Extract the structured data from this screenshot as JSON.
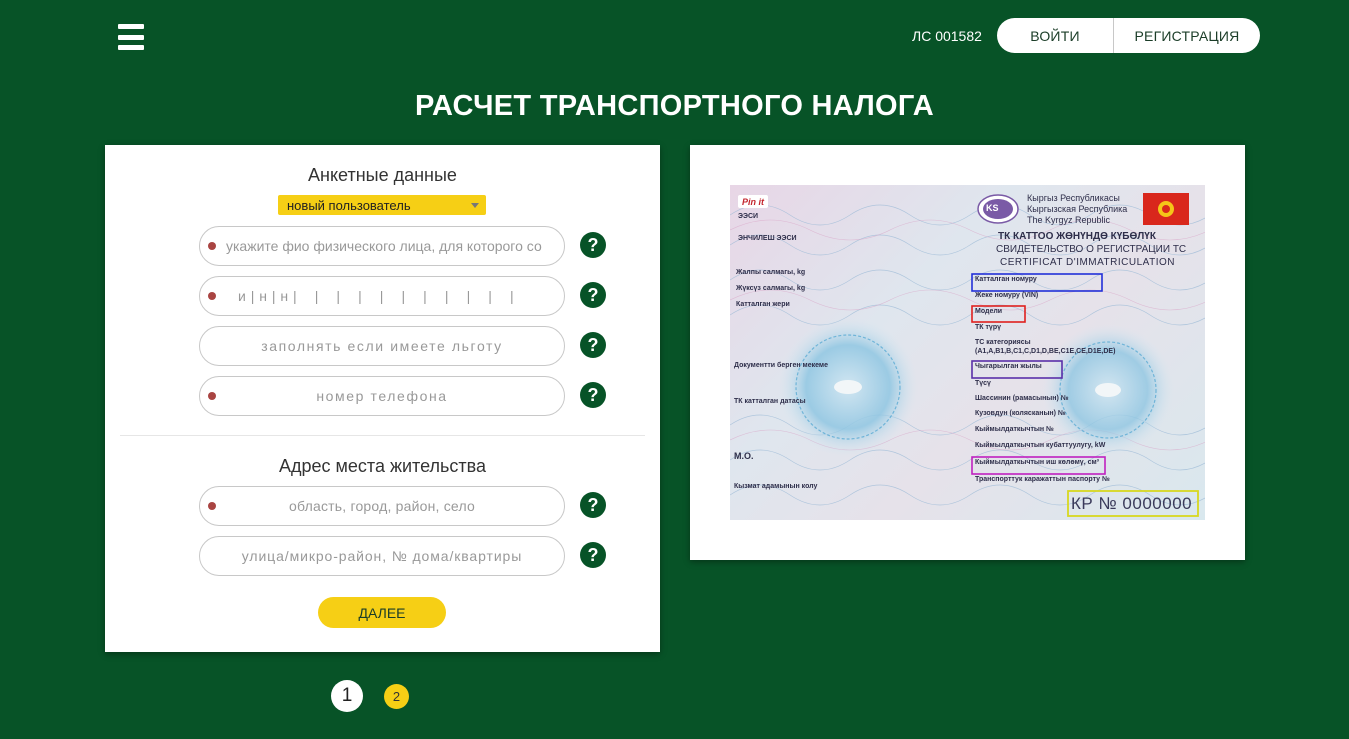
{
  "header": {
    "account_code": "ЛС 001582",
    "login_label": "ВОЙТИ",
    "register_label": "РЕГИСТРАЦИЯ"
  },
  "page_title": "РАСЧЕТ ТРАНСПОРТНОГО НАЛОГА",
  "form": {
    "personal_title": "Анкетные данные",
    "user_type_selected": "новый пользователь",
    "fio_placeholder": "укажите фио физического лица, для которого со",
    "inn_placeholder": "и | н | н |    |    |    |    |    |    |    |    |    |    |",
    "benefit_placeholder": "заполнять если имеете льготу",
    "phone_placeholder": "номер телефона",
    "address_title": "Адрес места жительства",
    "region_placeholder": "область, город, район, село",
    "street_placeholder": "улица/микро-район, № дома/квартиры",
    "next_label": "ДАЛЕЕ",
    "help_symbol": "?"
  },
  "steps": [
    "1",
    "2"
  ],
  "certificate": {
    "pinit": "Pin it",
    "country_ky": "Кыргыз Республикасы",
    "country_ru": "Кыргызская Республика",
    "country_en": "The Kyrgyz Republic",
    "ks": "KS",
    "heading_ky": "ТК КАТТОО ЖӨНҮНДӨ КҮБӨЛҮК",
    "heading_ru": "СВИДЕТЕЛЬСТВО О РЕГИСТРАЦИИ ТС",
    "heading_fr": "CERTIFICAT D'IMMATRICULATION",
    "left_fields": [
      "ЭЭСИ",
      "ЭНЧИЛЕШ ЭЭСИ",
      "Жалпы салмагы, kg",
      "Жүксүз салмагы, kg",
      "Катталган жери",
      "Документти берген мекеме",
      "ТК катталган датасы",
      "М.О.",
      "Кызмат адамынын колу"
    ],
    "right_fields": [
      "Катталган номуру",
      "Жеке номуру (VIN)",
      "Модели",
      "ТК түрү",
      "ТС категориясы",
      "(A1,A,B1,B,C1,C,D1,D,BE,C1E,CE,D1E,DE)",
      "Чыгарылган жылы",
      "Түсү",
      "Шассинин (рамасынын) №",
      "Кузовдун (колясканын) №",
      "Кыймылдаткычтын №",
      "Кыймылдаткычтын кубаттуулугу, kW",
      "Кыймылдаткычтын иш көлөмү, см³",
      "Транспорттук каражаттын паспорту №"
    ],
    "serial": "КР № 0000000"
  },
  "colors": {
    "background": "#075327",
    "accent": "#f6cf15",
    "required_dot": "#a94442"
  }
}
